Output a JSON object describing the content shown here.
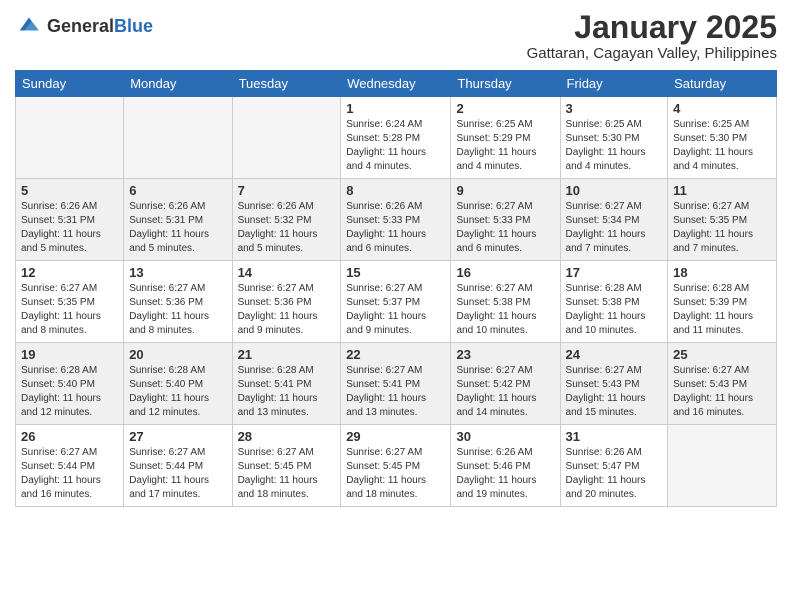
{
  "header": {
    "logo_general": "General",
    "logo_blue": "Blue",
    "month_title": "January 2025",
    "location": "Gattaran, Cagayan Valley, Philippines"
  },
  "days_of_week": [
    "Sunday",
    "Monday",
    "Tuesday",
    "Wednesday",
    "Thursday",
    "Friday",
    "Saturday"
  ],
  "weeks": [
    [
      {
        "day": "",
        "sunrise": "",
        "sunset": "",
        "daylight": "",
        "empty": true
      },
      {
        "day": "",
        "sunrise": "",
        "sunset": "",
        "daylight": "",
        "empty": true
      },
      {
        "day": "",
        "sunrise": "",
        "sunset": "",
        "daylight": "",
        "empty": true
      },
      {
        "day": "1",
        "sunrise": "Sunrise: 6:24 AM",
        "sunset": "Sunset: 5:28 PM",
        "daylight": "Daylight: 11 hours and 4 minutes."
      },
      {
        "day": "2",
        "sunrise": "Sunrise: 6:25 AM",
        "sunset": "Sunset: 5:29 PM",
        "daylight": "Daylight: 11 hours and 4 minutes."
      },
      {
        "day": "3",
        "sunrise": "Sunrise: 6:25 AM",
        "sunset": "Sunset: 5:30 PM",
        "daylight": "Daylight: 11 hours and 4 minutes."
      },
      {
        "day": "4",
        "sunrise": "Sunrise: 6:25 AM",
        "sunset": "Sunset: 5:30 PM",
        "daylight": "Daylight: 11 hours and 4 minutes."
      }
    ],
    [
      {
        "day": "5",
        "sunrise": "Sunrise: 6:26 AM",
        "sunset": "Sunset: 5:31 PM",
        "daylight": "Daylight: 11 hours and 5 minutes."
      },
      {
        "day": "6",
        "sunrise": "Sunrise: 6:26 AM",
        "sunset": "Sunset: 5:31 PM",
        "daylight": "Daylight: 11 hours and 5 minutes."
      },
      {
        "day": "7",
        "sunrise": "Sunrise: 6:26 AM",
        "sunset": "Sunset: 5:32 PM",
        "daylight": "Daylight: 11 hours and 5 minutes."
      },
      {
        "day": "8",
        "sunrise": "Sunrise: 6:26 AM",
        "sunset": "Sunset: 5:33 PM",
        "daylight": "Daylight: 11 hours and 6 minutes."
      },
      {
        "day": "9",
        "sunrise": "Sunrise: 6:27 AM",
        "sunset": "Sunset: 5:33 PM",
        "daylight": "Daylight: 11 hours and 6 minutes."
      },
      {
        "day": "10",
        "sunrise": "Sunrise: 6:27 AM",
        "sunset": "Sunset: 5:34 PM",
        "daylight": "Daylight: 11 hours and 7 minutes."
      },
      {
        "day": "11",
        "sunrise": "Sunrise: 6:27 AM",
        "sunset": "Sunset: 5:35 PM",
        "daylight": "Daylight: 11 hours and 7 minutes."
      }
    ],
    [
      {
        "day": "12",
        "sunrise": "Sunrise: 6:27 AM",
        "sunset": "Sunset: 5:35 PM",
        "daylight": "Daylight: 11 hours and 8 minutes."
      },
      {
        "day": "13",
        "sunrise": "Sunrise: 6:27 AM",
        "sunset": "Sunset: 5:36 PM",
        "daylight": "Daylight: 11 hours and 8 minutes."
      },
      {
        "day": "14",
        "sunrise": "Sunrise: 6:27 AM",
        "sunset": "Sunset: 5:36 PM",
        "daylight": "Daylight: 11 hours and 9 minutes."
      },
      {
        "day": "15",
        "sunrise": "Sunrise: 6:27 AM",
        "sunset": "Sunset: 5:37 PM",
        "daylight": "Daylight: 11 hours and 9 minutes."
      },
      {
        "day": "16",
        "sunrise": "Sunrise: 6:27 AM",
        "sunset": "Sunset: 5:38 PM",
        "daylight": "Daylight: 11 hours and 10 minutes."
      },
      {
        "day": "17",
        "sunrise": "Sunrise: 6:28 AM",
        "sunset": "Sunset: 5:38 PM",
        "daylight": "Daylight: 11 hours and 10 minutes."
      },
      {
        "day": "18",
        "sunrise": "Sunrise: 6:28 AM",
        "sunset": "Sunset: 5:39 PM",
        "daylight": "Daylight: 11 hours and 11 minutes."
      }
    ],
    [
      {
        "day": "19",
        "sunrise": "Sunrise: 6:28 AM",
        "sunset": "Sunset: 5:40 PM",
        "daylight": "Daylight: 11 hours and 12 minutes."
      },
      {
        "day": "20",
        "sunrise": "Sunrise: 6:28 AM",
        "sunset": "Sunset: 5:40 PM",
        "daylight": "Daylight: 11 hours and 12 minutes."
      },
      {
        "day": "21",
        "sunrise": "Sunrise: 6:28 AM",
        "sunset": "Sunset: 5:41 PM",
        "daylight": "Daylight: 11 hours and 13 minutes."
      },
      {
        "day": "22",
        "sunrise": "Sunrise: 6:27 AM",
        "sunset": "Sunset: 5:41 PM",
        "daylight": "Daylight: 11 hours and 13 minutes."
      },
      {
        "day": "23",
        "sunrise": "Sunrise: 6:27 AM",
        "sunset": "Sunset: 5:42 PM",
        "daylight": "Daylight: 11 hours and 14 minutes."
      },
      {
        "day": "24",
        "sunrise": "Sunrise: 6:27 AM",
        "sunset": "Sunset: 5:43 PM",
        "daylight": "Daylight: 11 hours and 15 minutes."
      },
      {
        "day": "25",
        "sunrise": "Sunrise: 6:27 AM",
        "sunset": "Sunset: 5:43 PM",
        "daylight": "Daylight: 11 hours and 16 minutes."
      }
    ],
    [
      {
        "day": "26",
        "sunrise": "Sunrise: 6:27 AM",
        "sunset": "Sunset: 5:44 PM",
        "daylight": "Daylight: 11 hours and 16 minutes."
      },
      {
        "day": "27",
        "sunrise": "Sunrise: 6:27 AM",
        "sunset": "Sunset: 5:44 PM",
        "daylight": "Daylight: 11 hours and 17 minutes."
      },
      {
        "day": "28",
        "sunrise": "Sunrise: 6:27 AM",
        "sunset": "Sunset: 5:45 PM",
        "daylight": "Daylight: 11 hours and 18 minutes."
      },
      {
        "day": "29",
        "sunrise": "Sunrise: 6:27 AM",
        "sunset": "Sunset: 5:45 PM",
        "daylight": "Daylight: 11 hours and 18 minutes."
      },
      {
        "day": "30",
        "sunrise": "Sunrise: 6:26 AM",
        "sunset": "Sunset: 5:46 PM",
        "daylight": "Daylight: 11 hours and 19 minutes."
      },
      {
        "day": "31",
        "sunrise": "Sunrise: 6:26 AM",
        "sunset": "Sunset: 5:47 PM",
        "daylight": "Daylight: 11 hours and 20 minutes."
      },
      {
        "day": "",
        "sunrise": "",
        "sunset": "",
        "daylight": "",
        "empty": true
      }
    ]
  ],
  "shaded_rows": [
    1,
    3
  ]
}
